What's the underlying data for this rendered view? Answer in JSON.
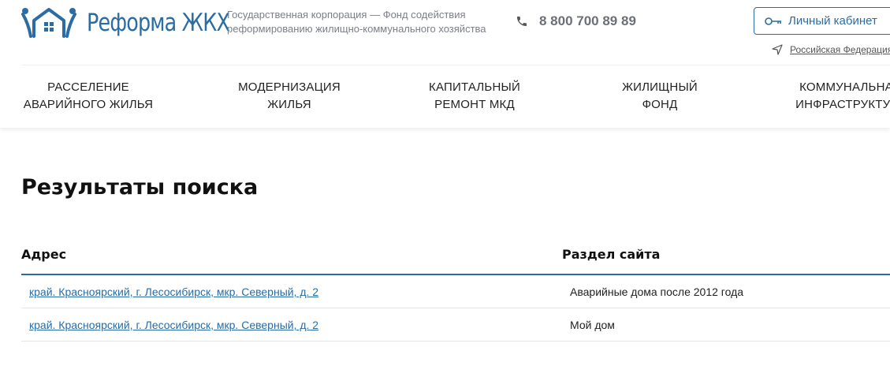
{
  "header": {
    "logo_text": "Реформа ЖКХ",
    "org_line1": "Государственная корпорация — Фонд содействия",
    "org_line2": "реформированию жилищно-коммунального хозяйства",
    "phone": "8 800 700 89 89",
    "cabinet_label": "Личный кабинет",
    "region_label": "Российская Федерация"
  },
  "nav": [
    {
      "label": "РАССЕЛЕНИЕ\nАВАРИЙНОГО ЖИЛЬЯ"
    },
    {
      "label": "МОДЕРНИЗАЦИЯ\nЖИЛЬЯ"
    },
    {
      "label": "КАПИТАЛЬНЫЙ\nРЕМОНТ МКД"
    },
    {
      "label": "ЖИЛИЩНЫЙ\nФОНД"
    },
    {
      "label": "КОММУНАЛЬНАЯ\nИНФРАСТРУКТУРА"
    }
  ],
  "page_title": "Результаты поиска",
  "table": {
    "headers": {
      "address": "Адрес",
      "section": "Раздел сайта"
    },
    "rows": [
      {
        "address": "край. Красноярский, г. Лесосибирск, мкр. Северный, д. 2",
        "section": "Аварийные дома после 2012 года"
      },
      {
        "address": "край. Красноярский, г. Лесосибирск, мкр. Северный, д. 2",
        "section": "Мой дом"
      }
    ]
  },
  "colors": {
    "brand": "#2a6ca3",
    "muted": "#7b7f86"
  },
  "icons": [
    "logo-houses-icon",
    "phone-icon",
    "key-icon",
    "location-arrow-icon"
  ]
}
